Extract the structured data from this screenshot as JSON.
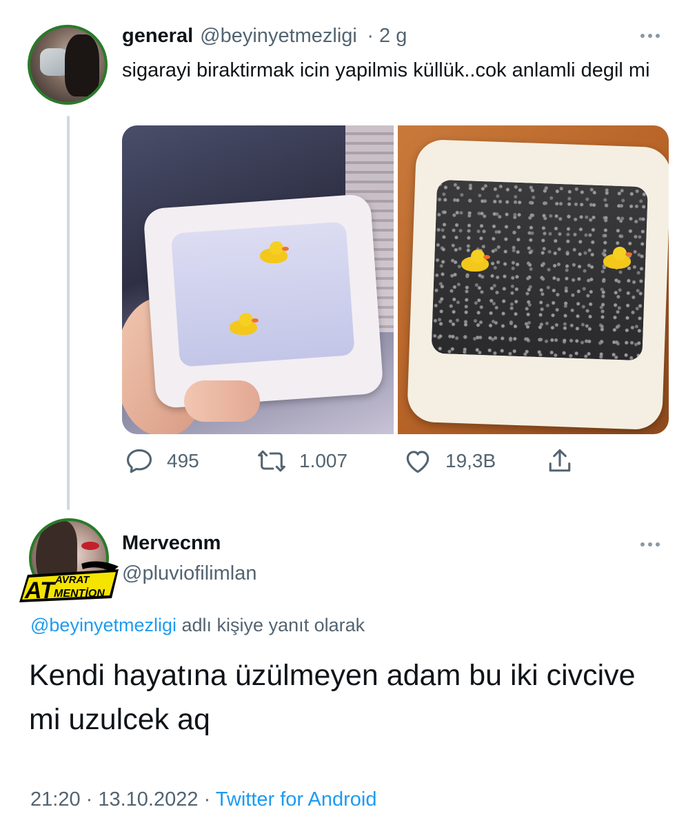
{
  "tweet": {
    "name": "general",
    "handle": "@beyinyetmezligi",
    "time": "· 2 g",
    "text": "sigarayi biraktirmak icin yapilmis küllük..cok anlamli degil mi",
    "stats": {
      "replies": "495",
      "retweets": "1.007",
      "likes": "19,3B"
    }
  },
  "reply": {
    "name": "Mervecnm",
    "handle": "@pluviofilimlan",
    "reply_to_handle": "@beyinyetmezligi",
    "reply_to_suffix": "adlı kişiye yanıt olarak",
    "text": "Kendi hayatına üzülmeyen adam bu iki civcive mi uzulcek aq",
    "time": "21:20",
    "date": "13.10.2022",
    "source": "Twitter for Android"
  },
  "badge": {
    "text_big": "AT",
    "text_top": "AVRAT",
    "text_bottom": "MENTİON"
  },
  "icons": [
    "reply-icon",
    "retweet-icon",
    "like-icon",
    "share-icon",
    "more-icon"
  ],
  "colors": {
    "link": "#1d9bf0",
    "secondary_text": "#536471",
    "thread_line": "#cfd9de",
    "avatar_ring": "#2a7a2a",
    "badge_yellow": "#f5e400"
  }
}
